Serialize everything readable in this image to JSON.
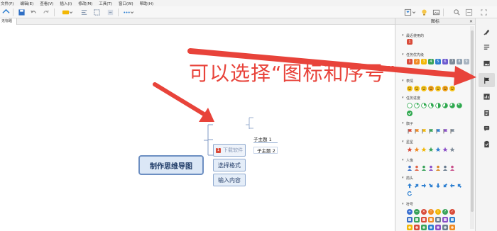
{
  "menubar": {
    "items": [
      "文件(F)",
      "编辑(E)",
      "查看(V)",
      "插入(I)",
      "修改(M)",
      "工具(T)",
      "窗口(W)",
      "帮助(H)"
    ]
  },
  "tab": {
    "label": "无标题"
  },
  "mindmap": {
    "central": "制作思维导图",
    "topics": [
      "下载软件",
      "选择格式",
      "输入内容"
    ],
    "subtopics": [
      "子主题 1",
      "子主题 2"
    ],
    "marker_number": "1"
  },
  "panel": {
    "title": "图标",
    "close": "✕",
    "sections": [
      "最近使用的",
      "任务优先级",
      "表情",
      "任务进度",
      "旗子",
      "星星",
      "人像",
      "箭头",
      "符号"
    ],
    "recent_badge": "1",
    "priority_numbers": [
      "1",
      "2",
      "3",
      "4",
      "5",
      "6",
      "7",
      "8",
      "9"
    ],
    "priority_colors": [
      "#d94b3a",
      "#f08a24",
      "#f2b705",
      "#3aa35b",
      "#2f7fd1",
      "#6d5bd0",
      "#7d8b99",
      "#8fa0b0",
      "#a8b4c0"
    ],
    "smiley_colors": [
      "#f4c21b",
      "#f4c21b",
      "#f4c21b",
      "#f0a21b",
      "#f4c21b",
      "#f0a21b",
      "#f4c21b"
    ],
    "flag_colors": [
      "#d94b3a",
      "#f08a24",
      "#f2b705",
      "#3aa35b",
      "#2f7fd1",
      "#8a4fc7",
      "#7d8b99"
    ],
    "star_colors": [
      "#d94b3a",
      "#f08a24",
      "#f2b705",
      "#3aa35b",
      "#2f7fd1",
      "#8a4fc7",
      "#7d8b99"
    ],
    "person_colors": [
      "#3b6fc4",
      "#e0654a",
      "#3aa35b",
      "#8a4fc7",
      "#d98a2a",
      "#6a7d8f",
      "#c94f8a"
    ],
    "symbol_colors": [
      "#3a6fd1",
      "#3aa35b",
      "#d94b3a",
      "#f08a24",
      "#f2b705",
      "#3aa35b",
      "#d94b3a"
    ]
  },
  "annotation": {
    "text": "可以选择“图标和序号”"
  },
  "colors": {
    "accent_red": "#e8433a",
    "topic_border": "#6d8fc2",
    "topic_fill": "#dbe7f6"
  }
}
